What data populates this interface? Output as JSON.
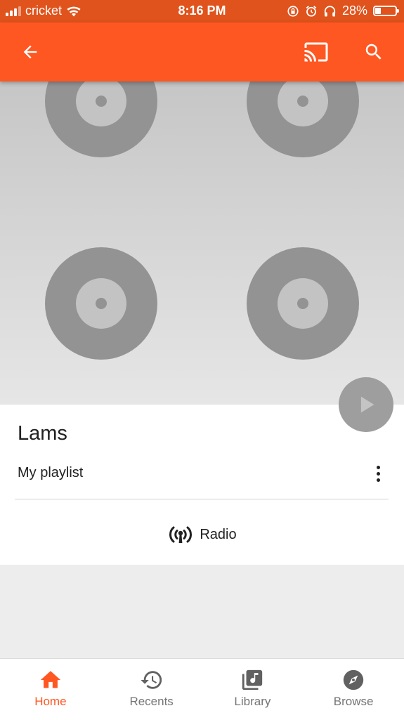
{
  "status_bar": {
    "carrier": "cricket",
    "time": "8:16 PM",
    "battery": "28%"
  },
  "app_bar": {
    "back_icon": "arrow-left-icon",
    "cast_icon": "cast-icon",
    "search_icon": "search-icon"
  },
  "playlist": {
    "title": "Lams",
    "subtitle": "My playlist",
    "radio_label": "Radio"
  },
  "bottom_nav": {
    "items": [
      {
        "label": "Home",
        "icon": "home-icon",
        "active": true
      },
      {
        "label": "Recents",
        "icon": "history-icon",
        "active": false
      },
      {
        "label": "Library",
        "icon": "library-music-icon",
        "active": false
      },
      {
        "label": "Browse",
        "icon": "compass-icon",
        "active": false
      }
    ]
  },
  "colors": {
    "status_bar": "#e0531c",
    "app_bar": "#ff5722",
    "accent": "#ff5722"
  }
}
